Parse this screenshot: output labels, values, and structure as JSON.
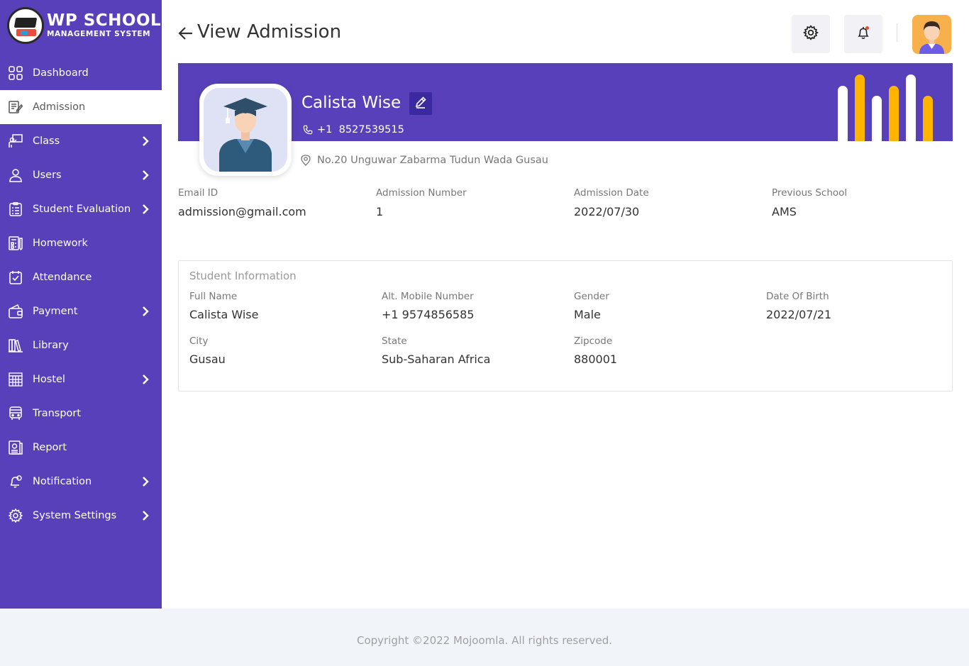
{
  "brand": {
    "title": "WP SCHOOL",
    "subtitle": "MANAGEMENT SYSTEM"
  },
  "sidebar": {
    "items": [
      {
        "label": "Dashboard",
        "icon": "dashboard-grid-icon",
        "has_submenu": false,
        "active": false
      },
      {
        "label": "Admission",
        "icon": "admission-form-icon",
        "has_submenu": false,
        "active": true
      },
      {
        "label": "Class",
        "icon": "class-teacher-icon",
        "has_submenu": true,
        "active": false
      },
      {
        "label": "Users",
        "icon": "user-icon",
        "has_submenu": true,
        "active": false
      },
      {
        "label": "Student Evaluation",
        "icon": "evaluation-clipboard-icon",
        "has_submenu": true,
        "active": false
      },
      {
        "label": "Homework",
        "icon": "homework-icon",
        "has_submenu": false,
        "active": false
      },
      {
        "label": "Attendance",
        "icon": "attendance-check-icon",
        "has_submenu": false,
        "active": false
      },
      {
        "label": "Payment",
        "icon": "wallet-icon",
        "has_submenu": true,
        "active": false
      },
      {
        "label": "Library",
        "icon": "library-books-icon",
        "has_submenu": false,
        "active": false
      },
      {
        "label": "Hostel",
        "icon": "hostel-building-icon",
        "has_submenu": true,
        "active": false
      },
      {
        "label": "Transport",
        "icon": "bus-icon",
        "has_submenu": false,
        "active": false
      },
      {
        "label": "Report",
        "icon": "report-icon",
        "has_submenu": false,
        "active": false
      },
      {
        "label": "Notification",
        "icon": "bell-icon",
        "has_submenu": true,
        "active": false
      },
      {
        "label": "System Settings",
        "icon": "gear-icon",
        "has_submenu": true,
        "active": false
      }
    ]
  },
  "header": {
    "title": "View Admission"
  },
  "profile": {
    "name": "Calista Wise",
    "phone": "+1  8527539515",
    "address": "No.20 Unguwar Zabarma Tudun Wada Gusau"
  },
  "summary": [
    {
      "label": "Email ID",
      "value": "admission@gmail.com"
    },
    {
      "label": "Admission Number",
      "value": "1"
    },
    {
      "label": "Admission Date",
      "value": "2022/07/30"
    },
    {
      "label": "Previous School",
      "value": "AMS"
    }
  ],
  "student_info": {
    "title": "Student Information",
    "fields": [
      {
        "label": "Full Name",
        "value": "Calista Wise"
      },
      {
        "label": "Alt. Mobile Number",
        "value": "+1 9574856585"
      },
      {
        "label": "Gender",
        "value": "Male"
      },
      {
        "label": "Date Of Birth",
        "value": "2022/07/21"
      },
      {
        "label": "City",
        "value": "Gusau"
      },
      {
        "label": "State",
        "value": "Sub-Saharan Africa"
      },
      {
        "label": "Zipcode",
        "value": "880001"
      }
    ]
  },
  "footer": {
    "text": "Copyright ©2022 Mojoomla. All rights reserved."
  },
  "colors": {
    "primary": "#5840bb",
    "accent": "#ffb400",
    "footer_bg": "#f1f4f9"
  }
}
